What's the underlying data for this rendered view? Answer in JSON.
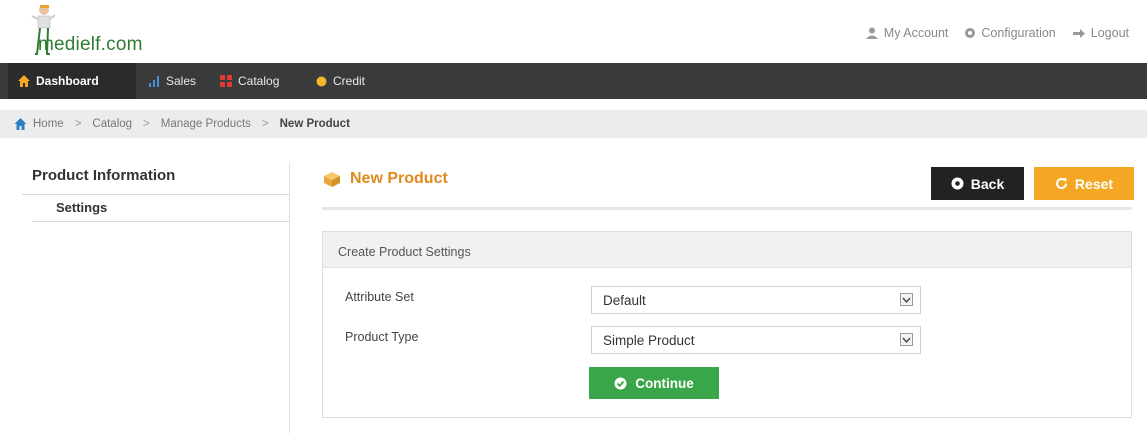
{
  "header": {
    "logo_text": "medielf.com",
    "links": {
      "my_account": "My Account",
      "configuration": "Configuration",
      "logout": "Logout"
    }
  },
  "nav": {
    "dashboard": "Dashboard",
    "sales": "Sales",
    "catalog": "Catalog",
    "credit": "Credit"
  },
  "breadcrumb": {
    "home": "Home",
    "catalog": "Catalog",
    "manage_products": "Manage Products",
    "current": "New Product"
  },
  "sidebar": {
    "title": "Product Information",
    "items": [
      {
        "label": "Settings"
      }
    ]
  },
  "main": {
    "title": "New Product",
    "back_label": "Back",
    "reset_label": "Reset",
    "panel": {
      "heading": "Create Product Settings",
      "attribute_set_label": "Attribute Set",
      "attribute_set_value": "Default",
      "product_type_label": "Product Type",
      "product_type_value": "Simple Product",
      "continue_label": "Continue"
    }
  },
  "colors": {
    "nav_bg": "#3a3a3a",
    "accent_orange": "#f5a623",
    "title_orange": "#e08a1e",
    "continue_green": "#3aa64a",
    "back_dark": "#222222"
  }
}
